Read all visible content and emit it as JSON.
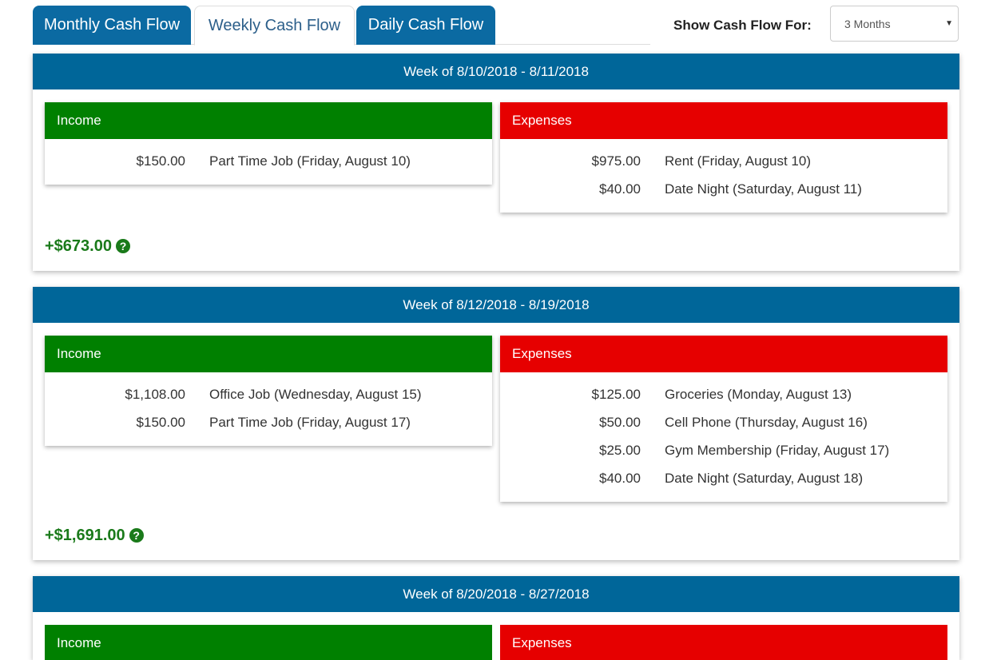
{
  "tabs": [
    {
      "label": "Monthly Cash Flow",
      "active": false
    },
    {
      "label": "Weekly Cash Flow",
      "active": true
    },
    {
      "label": "Daily Cash Flow",
      "active": false
    }
  ],
  "filter": {
    "label": "Show Cash Flow For:",
    "selected": "3 Months"
  },
  "colors": {
    "header": "#006699",
    "income": "#008000",
    "expenses": "#e60000",
    "net_positive": "#1a7a1a"
  },
  "icons": {
    "help": "question-circle-icon",
    "dropdown": "caret-down-icon"
  },
  "weeks": [
    {
      "title": "Week of 8/10/2018 - 8/11/2018",
      "income_label": "Income",
      "expenses_label": "Expenses",
      "income": [
        {
          "amount": "$150.00",
          "desc": "Part Time Job (Friday, August 10)"
        }
      ],
      "expenses": [
        {
          "amount": "$975.00",
          "desc": "Rent (Friday, August 10)"
        },
        {
          "amount": "$40.00",
          "desc": "Date Night (Saturday, August 11)"
        }
      ],
      "net": "+$673.00"
    },
    {
      "title": "Week of 8/12/2018 - 8/19/2018",
      "income_label": "Income",
      "expenses_label": "Expenses",
      "income": [
        {
          "amount": "$1,108.00",
          "desc": "Office Job (Wednesday, August 15)"
        },
        {
          "amount": "$150.00",
          "desc": "Part Time Job (Friday, August 17)"
        }
      ],
      "expenses": [
        {
          "amount": "$125.00",
          "desc": "Groceries (Monday, August 13)"
        },
        {
          "amount": "$50.00",
          "desc": "Cell Phone (Thursday, August 16)"
        },
        {
          "amount": "$25.00",
          "desc": "Gym Membership (Friday, August 17)"
        },
        {
          "amount": "$40.00",
          "desc": "Date Night (Saturday, August 18)"
        }
      ],
      "net": "+$1,691.00"
    },
    {
      "title": "Week of 8/20/2018 - 8/27/2018",
      "income_label": "Income",
      "expenses_label": "Expenses",
      "income": [],
      "expenses": []
    }
  ]
}
